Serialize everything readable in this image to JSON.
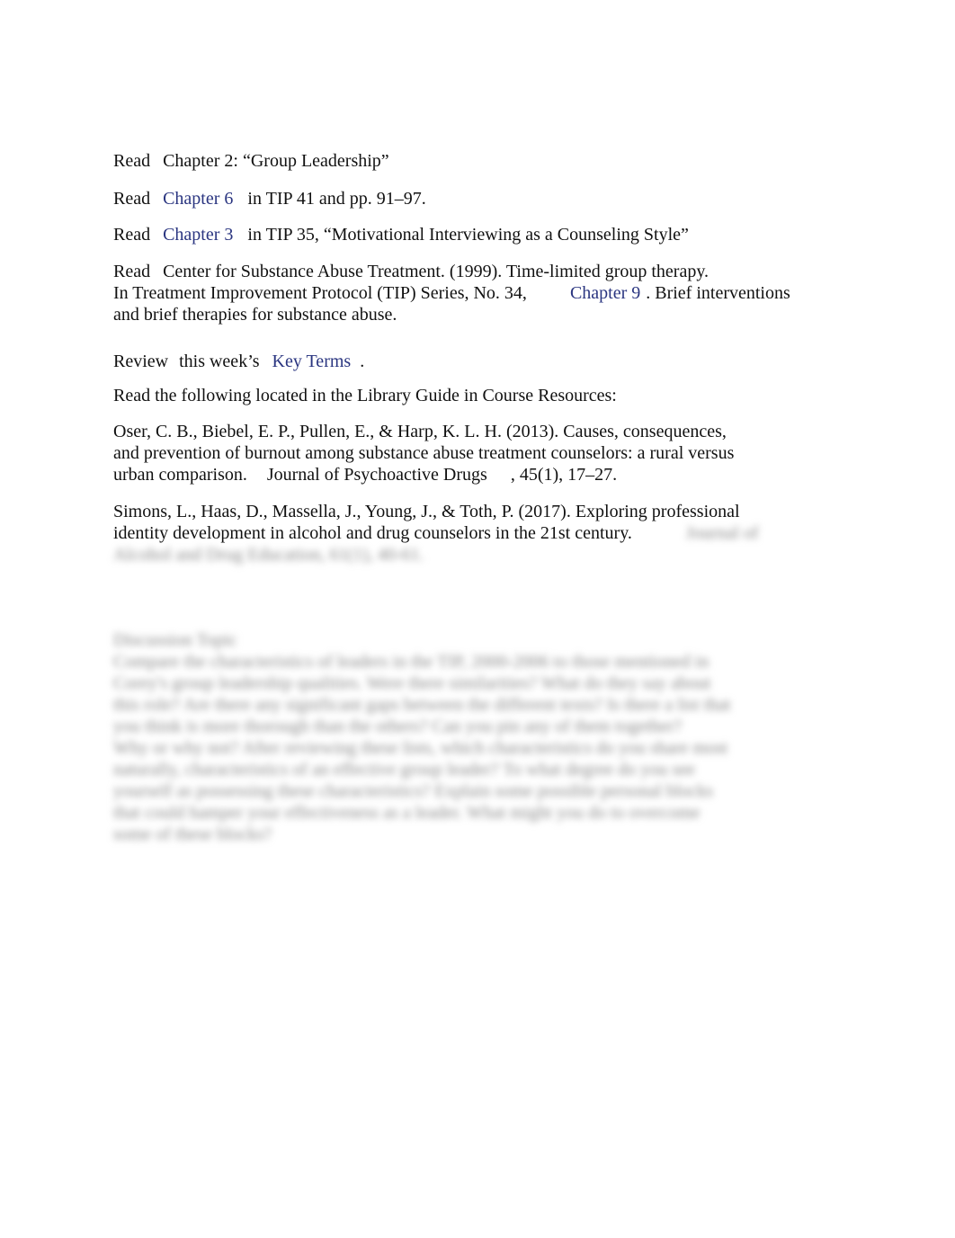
{
  "items": [
    {
      "verb": "Read",
      "text": "Chapter 2: “Group Leadership”"
    },
    {
      "verb": "Read",
      "link": "Chapter 6",
      "after": "in TIP 41 and pp. 91–97."
    },
    {
      "verb": "Read",
      "link": "Chapter 3",
      "after": "in TIP 35, “Motivational Interviewing as a Counseling Style”"
    },
    {
      "verb": "Read",
      "line1": "Center for Substance Abuse Treatment. (1999). Time-limited group therapy.",
      "line2_before": "In Treatment Improvement Protocol (TIP) Series, No. 34,",
      "link": "Chapter 9",
      "line2_after": ". Brief interventions",
      "line3": "and brief therapies for substance abuse."
    },
    {
      "verb": "Review",
      "before": "this week’s",
      "link": "Key Terms",
      "after": "."
    }
  ],
  "library_intro": "Read the following located in the Library Guide in Course Resources:",
  "refs": [
    {
      "l1": "Oser, C. B., Biebel, E. P., Pullen, E., & Harp, K. L. H. (2013). Causes, consequences,",
      "l2": "and prevention of burnout among substance abuse treatment counselors: a rural versus",
      "l3a": "urban comparison.",
      "l3b": "Journal of Psychoactive Drugs",
      "l3c": ", 45(1), 17–27."
    },
    {
      "l1": "Simons, L., Haas, D., Massella, J., Young, J., & Toth, P. (2017). Exploring professional",
      "l2": "identity development in alcohol and drug counselors in the 21st century.",
      "l2_blur": "Journal of",
      "l3_blur": "Alcohol and Drug Education, 61(1), 40-61."
    }
  ],
  "blurred": {
    "heading": "Discussion Topic",
    "lines": [
      "Compare the characteristics of leaders in the TIP, 2000-2006 to those mentioned in",
      "Corey's group leadership qualities. Were there similarities? What do they say about",
      "this role? Are there any significant gaps between the different texts? Is there a list that",
      "you think is more thorough than the others? Can you pin any of them together?",
      "Why or why not? After reviewing these lists, which characteristics do you share most",
      "naturally, characteristics of an effective group leader? To what degree do you see",
      "yourself as possessing these characteristics? Explain some possible personal blocks",
      "that could hamper your effectiveness as a leader. What might you do to overcome",
      "some of these blocks?"
    ]
  }
}
